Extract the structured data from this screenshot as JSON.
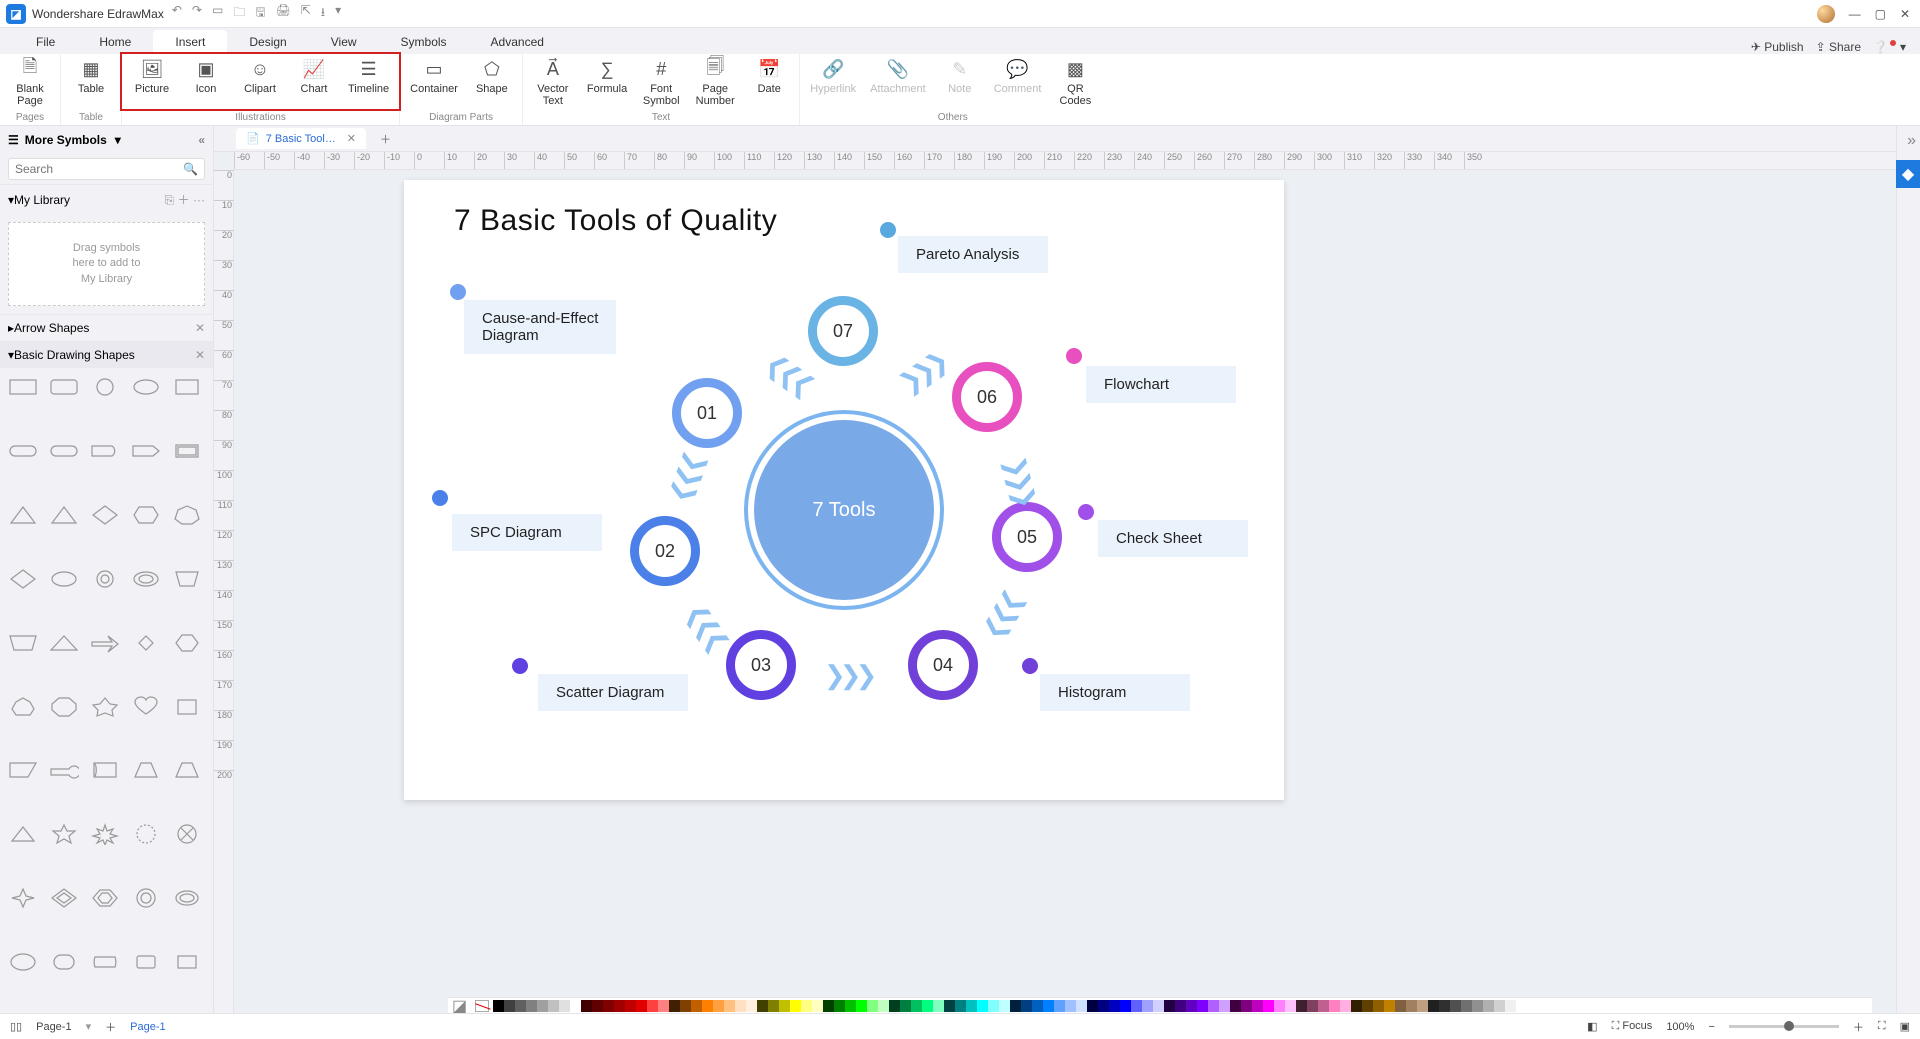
{
  "app": {
    "title": "Wondershare EdrawMax"
  },
  "menu": {
    "items": [
      "File",
      "Home",
      "Insert",
      "Design",
      "View",
      "Symbols",
      "Advanced"
    ],
    "active": "Insert",
    "publish": "Publish",
    "share": "Share"
  },
  "ribbon": {
    "pages": {
      "blank": "Blank\nPage",
      "group": "Pages"
    },
    "table": {
      "btn": "Table",
      "group": "Table"
    },
    "illustrations": {
      "picture": "Picture",
      "icon": "Icon",
      "clipart": "Clipart",
      "chart": "Chart",
      "timeline": "Timeline",
      "group": "Illustrations"
    },
    "diagramparts": {
      "container": "Container",
      "shape": "Shape",
      "group": "Diagram Parts"
    },
    "text": {
      "vector": "Vector\nText",
      "formula": "Formula",
      "fontsymbol": "Font\nSymbol",
      "pagenumber": "Page\nNumber",
      "date": "Date",
      "group": "Text"
    },
    "others": {
      "hyperlink": "Hyperlink",
      "attachment": "Attachment",
      "note": "Note",
      "comment": "Comment",
      "qrcodes": "QR\nCodes",
      "group": "Others"
    }
  },
  "symbols": {
    "title": "More Symbols",
    "search_placeholder": "Search",
    "mylibrary": "My Library",
    "dropzone": "Drag symbols\nhere to add to\nMy Library",
    "arrow_shapes": "Arrow Shapes",
    "basic_shapes": "Basic Drawing Shapes"
  },
  "doc": {
    "tab": "7 Basic Tools O..."
  },
  "ruler": {
    "h": [
      "-60",
      "-50",
      "-40",
      "-30",
      "-20",
      "-10",
      "0",
      "10",
      "20",
      "30",
      "40",
      "50",
      "60",
      "70",
      "80",
      "90",
      "100",
      "110",
      "120",
      "130",
      "140",
      "150",
      "160",
      "170",
      "180",
      "190",
      "200",
      "210",
      "220",
      "230",
      "240",
      "250",
      "260",
      "270",
      "280",
      "290",
      "300",
      "310",
      "320",
      "330",
      "340",
      "350"
    ],
    "v": [
      "0",
      "10",
      "20",
      "30",
      "40",
      "50",
      "60",
      "70",
      "80",
      "90",
      "100",
      "110",
      "120",
      "130",
      "140",
      "150",
      "160",
      "170",
      "180",
      "190",
      "200"
    ]
  },
  "diagram": {
    "title": "7 Basic Tools of  Quality",
    "center": "7 Tools",
    "nodes": {
      "n01": "01",
      "n02": "02",
      "n03": "03",
      "n04": "04",
      "n05": "05",
      "n06": "06",
      "n07": "07"
    },
    "labels": {
      "pareto": "Pareto Analysis",
      "flowchart": "Flowchart",
      "checksheet": "Check Sheet",
      "histogram": "Histogram",
      "scatter": "Scatter Diagram",
      "spc": "SPC Diagram",
      "cause": "Cause-and-Effect\nDiagram"
    }
  },
  "status": {
    "page_label": "Page-1",
    "page_link": "Page-1",
    "focus": "Focus",
    "zoom": "100%"
  },
  "colors": [
    "#000000",
    "#404040",
    "#606060",
    "#808080",
    "#a0a0a0",
    "#c0c0c0",
    "#e0e0e0",
    "#ffffff",
    "#400000",
    "#600000",
    "#800000",
    "#a00000",
    "#c00000",
    "#e00000",
    "#ff4040",
    "#ff8080",
    "#402000",
    "#804000",
    "#c06000",
    "#ff8000",
    "#ffa040",
    "#ffc080",
    "#ffe0c0",
    "#fff0e0",
    "#404000",
    "#808000",
    "#c0c000",
    "#ffff00",
    "#ffff80",
    "#ffffc0",
    "#004000",
    "#008000",
    "#00c000",
    "#00ff00",
    "#80ff80",
    "#c0ffc0",
    "#004020",
    "#008040",
    "#00c060",
    "#00ff80",
    "#80ffc0",
    "#004040",
    "#008080",
    "#00c0c0",
    "#00ffff",
    "#80ffff",
    "#c0ffff",
    "#002040",
    "#004080",
    "#0060c0",
    "#0080ff",
    "#60a0ff",
    "#a0c0ff",
    "#d0e0ff",
    "#000040",
    "#000080",
    "#0000c0",
    "#0000ff",
    "#6060ff",
    "#a0a0ff",
    "#d0d0ff",
    "#200040",
    "#400080",
    "#6000c0",
    "#8000ff",
    "#b060ff",
    "#d0a0ff",
    "#400040",
    "#800080",
    "#c000c0",
    "#ff00ff",
    "#ff80ff",
    "#ffc0ff",
    "#402030",
    "#804060",
    "#c06090",
    "#ff80c0",
    "#ffb0e0",
    "#302000",
    "#604000",
    "#906000",
    "#c08000",
    "#806040",
    "#a08060",
    "#c0a080",
    "#202020",
    "#303030",
    "#505050",
    "#707070",
    "#909090",
    "#b0b0b0",
    "#d0d0d0",
    "#f0f0f0"
  ]
}
